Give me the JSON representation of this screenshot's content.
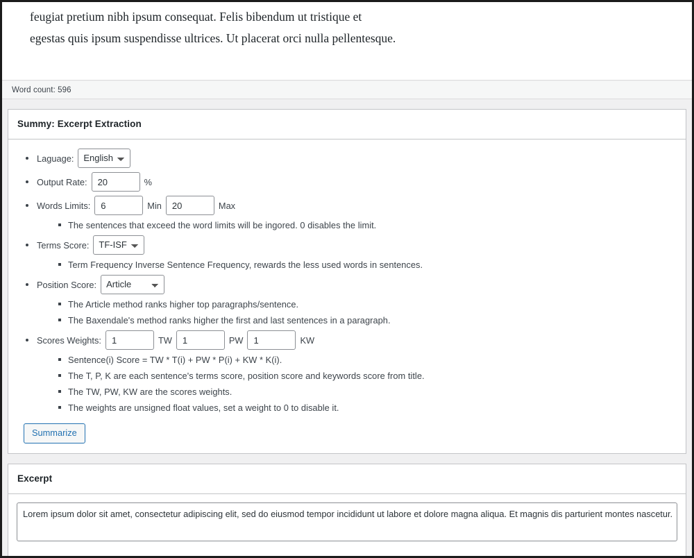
{
  "editor": {
    "paragraph_lines": [
      "feugiat pretium nibh ipsum consequat. Felis bibendum ut tristique et",
      "egestas quis ipsum suspendisse ultrices. Ut placerat orci nulla pellentesque."
    ],
    "word_count_label": "Word count: 596"
  },
  "summy_panel": {
    "title": "Summy: Excerpt Extraction",
    "language": {
      "label": "Laguage:",
      "value": "English",
      "options": [
        "English"
      ]
    },
    "output_rate": {
      "label": "Output Rate:",
      "value": "20",
      "suffix": "%"
    },
    "words_limits": {
      "label": "Words Limits:",
      "min_value": "6",
      "min_suffix": "Min",
      "max_value": "20",
      "max_suffix": "Max",
      "note": "The sentences that exceed the word limits will be ingored. 0 disables the limit."
    },
    "terms_score": {
      "label": "Terms Score:",
      "value": "TF-ISF",
      "options": [
        "TF-ISF"
      ],
      "note": "Term Frequency Inverse Sentence Frequency, rewards the less used words in sentences."
    },
    "position_score": {
      "label": "Position Score:",
      "value": "Article",
      "options": [
        "Article"
      ],
      "notes": [
        "The Article method ranks higher top paragraphs/sentence.",
        "The Baxendale's method ranks higher the first and last sentences in a paragraph."
      ]
    },
    "scores_weights": {
      "label": "Scores Weights:",
      "tw_value": "1",
      "tw_suffix": "TW",
      "pw_value": "1",
      "pw_suffix": "PW",
      "kw_value": "1",
      "kw_suffix": "KW",
      "notes": [
        "Sentence(i) Score = TW * T(i) + PW * P(i) + KW * K(i).",
        "The T, P, K are each sentence's terms score, position score and keywords score from title.",
        "The TW, PW, KW are the scores weights.",
        "The weights are unsigned float values, set a weight to 0 to disable it."
      ]
    },
    "summarize_button": "Summarize"
  },
  "excerpt_panel": {
    "title": "Excerpt",
    "value": "Lorem ipsum dolor sit amet, consectetur adipiscing elit, sed do eiusmod tempor incididunt ut labore et dolore magna aliqua. Et magnis dis parturient montes nascetur.",
    "placeholder": ""
  },
  "colors": {
    "accent": "#2271b1",
    "panel_border": "#c3c4c7",
    "page_bg": "#f0f0f1",
    "text": "#3c434a"
  }
}
